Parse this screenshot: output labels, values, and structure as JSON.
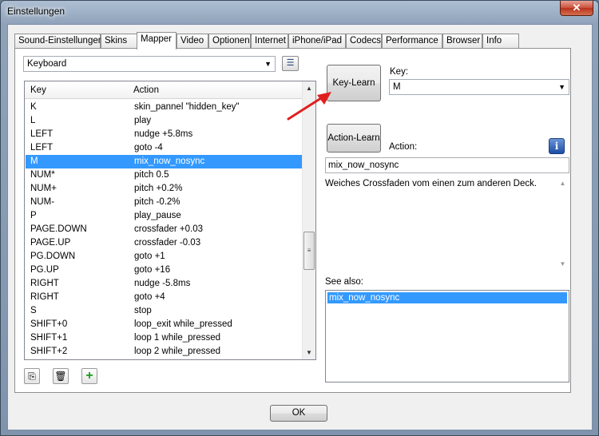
{
  "window": {
    "title": "Einstellungen",
    "close_label": "✕"
  },
  "tabs": [
    {
      "label": "Sound-Einstellungen",
      "active": false
    },
    {
      "label": "Skins",
      "active": false
    },
    {
      "label": "Mapper",
      "active": true
    },
    {
      "label": "Video",
      "active": false
    },
    {
      "label": "Optionen",
      "active": false
    },
    {
      "label": "Internet",
      "active": false
    },
    {
      "label": "iPhone/iPad",
      "active": false
    },
    {
      "label": "Codecs",
      "active": false
    },
    {
      "label": "Performance",
      "active": false
    },
    {
      "label": "Browser",
      "active": false
    },
    {
      "label": "Info",
      "active": false
    }
  ],
  "mapper": {
    "device_select": "Keyboard",
    "list": {
      "col_key": "Key",
      "col_action": "Action",
      "rows": [
        {
          "key": "K",
          "action": "skin_pannel \"hidden_key\""
        },
        {
          "key": "L",
          "action": "play"
        },
        {
          "key": "LEFT",
          "action": "nudge +5.8ms"
        },
        {
          "key": "LEFT",
          "action": "goto -4"
        },
        {
          "key": "M",
          "action": "mix_now_nosync",
          "selected": true
        },
        {
          "key": "NUM*",
          "action": "pitch 0.5"
        },
        {
          "key": "NUM+",
          "action": "pitch +0.2%"
        },
        {
          "key": "NUM-",
          "action": "pitch -0.2%"
        },
        {
          "key": "P",
          "action": "play_pause"
        },
        {
          "key": "PAGE.DOWN",
          "action": "crossfader +0.03"
        },
        {
          "key": "PAGE.UP",
          "action": "crossfader -0.03"
        },
        {
          "key": "PG.DOWN",
          "action": "goto +1"
        },
        {
          "key": "PG.UP",
          "action": "goto +16"
        },
        {
          "key": "RIGHT",
          "action": "nudge -5.8ms"
        },
        {
          "key": "RIGHT",
          "action": "goto +4"
        },
        {
          "key": "S",
          "action": "stop"
        },
        {
          "key": "SHIFT+0",
          "action": "loop_exit while_pressed"
        },
        {
          "key": "SHIFT+1",
          "action": "loop 1 while_pressed"
        },
        {
          "key": "SHIFT+2",
          "action": "loop 2 while_pressed"
        }
      ]
    },
    "key_learn_label": "Key-Learn",
    "key_label": "Key:",
    "key_value": "M",
    "action_learn_label": "Action-Learn",
    "action_label": "Action:",
    "action_value": "mix_now_nosync",
    "description": "Weiches Crossfaden vom einen zum anderen Deck.",
    "see_also_label": "See also:",
    "see_also_items": [
      "mix_now_nosync"
    ]
  },
  "footer": {
    "ok_label": "OK"
  },
  "colors": {
    "selection": "#3399ff",
    "annotation_arrow": "#e02020"
  }
}
